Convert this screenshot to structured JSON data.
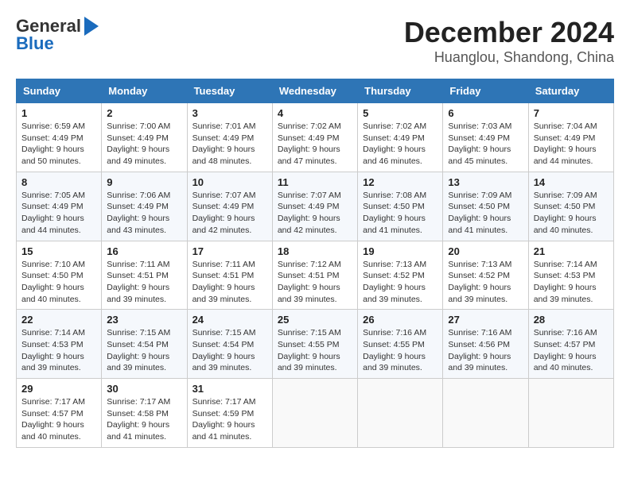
{
  "header": {
    "logo_line1": "General",
    "logo_line2": "Blue",
    "title": "December 2024",
    "subtitle": "Huanglou, Shandong, China"
  },
  "weekdays": [
    "Sunday",
    "Monday",
    "Tuesday",
    "Wednesday",
    "Thursday",
    "Friday",
    "Saturday"
  ],
  "weeks": [
    [
      {
        "day": "1",
        "sunrise": "Sunrise: 6:59 AM",
        "sunset": "Sunset: 4:49 PM",
        "daylight": "Daylight: 9 hours and 50 minutes."
      },
      {
        "day": "2",
        "sunrise": "Sunrise: 7:00 AM",
        "sunset": "Sunset: 4:49 PM",
        "daylight": "Daylight: 9 hours and 49 minutes."
      },
      {
        "day": "3",
        "sunrise": "Sunrise: 7:01 AM",
        "sunset": "Sunset: 4:49 PM",
        "daylight": "Daylight: 9 hours and 48 minutes."
      },
      {
        "day": "4",
        "sunrise": "Sunrise: 7:02 AM",
        "sunset": "Sunset: 4:49 PM",
        "daylight": "Daylight: 9 hours and 47 minutes."
      },
      {
        "day": "5",
        "sunrise": "Sunrise: 7:02 AM",
        "sunset": "Sunset: 4:49 PM",
        "daylight": "Daylight: 9 hours and 46 minutes."
      },
      {
        "day": "6",
        "sunrise": "Sunrise: 7:03 AM",
        "sunset": "Sunset: 4:49 PM",
        "daylight": "Daylight: 9 hours and 45 minutes."
      },
      {
        "day": "7",
        "sunrise": "Sunrise: 7:04 AM",
        "sunset": "Sunset: 4:49 PM",
        "daylight": "Daylight: 9 hours and 44 minutes."
      }
    ],
    [
      {
        "day": "8",
        "sunrise": "Sunrise: 7:05 AM",
        "sunset": "Sunset: 4:49 PM",
        "daylight": "Daylight: 9 hours and 44 minutes."
      },
      {
        "day": "9",
        "sunrise": "Sunrise: 7:06 AM",
        "sunset": "Sunset: 4:49 PM",
        "daylight": "Daylight: 9 hours and 43 minutes."
      },
      {
        "day": "10",
        "sunrise": "Sunrise: 7:07 AM",
        "sunset": "Sunset: 4:49 PM",
        "daylight": "Daylight: 9 hours and 42 minutes."
      },
      {
        "day": "11",
        "sunrise": "Sunrise: 7:07 AM",
        "sunset": "Sunset: 4:49 PM",
        "daylight": "Daylight: 9 hours and 42 minutes."
      },
      {
        "day": "12",
        "sunrise": "Sunrise: 7:08 AM",
        "sunset": "Sunset: 4:50 PM",
        "daylight": "Daylight: 9 hours and 41 minutes."
      },
      {
        "day": "13",
        "sunrise": "Sunrise: 7:09 AM",
        "sunset": "Sunset: 4:50 PM",
        "daylight": "Daylight: 9 hours and 41 minutes."
      },
      {
        "day": "14",
        "sunrise": "Sunrise: 7:09 AM",
        "sunset": "Sunset: 4:50 PM",
        "daylight": "Daylight: 9 hours and 40 minutes."
      }
    ],
    [
      {
        "day": "15",
        "sunrise": "Sunrise: 7:10 AM",
        "sunset": "Sunset: 4:50 PM",
        "daylight": "Daylight: 9 hours and 40 minutes."
      },
      {
        "day": "16",
        "sunrise": "Sunrise: 7:11 AM",
        "sunset": "Sunset: 4:51 PM",
        "daylight": "Daylight: 9 hours and 39 minutes."
      },
      {
        "day": "17",
        "sunrise": "Sunrise: 7:11 AM",
        "sunset": "Sunset: 4:51 PM",
        "daylight": "Daylight: 9 hours and 39 minutes."
      },
      {
        "day": "18",
        "sunrise": "Sunrise: 7:12 AM",
        "sunset": "Sunset: 4:51 PM",
        "daylight": "Daylight: 9 hours and 39 minutes."
      },
      {
        "day": "19",
        "sunrise": "Sunrise: 7:13 AM",
        "sunset": "Sunset: 4:52 PM",
        "daylight": "Daylight: 9 hours and 39 minutes."
      },
      {
        "day": "20",
        "sunrise": "Sunrise: 7:13 AM",
        "sunset": "Sunset: 4:52 PM",
        "daylight": "Daylight: 9 hours and 39 minutes."
      },
      {
        "day": "21",
        "sunrise": "Sunrise: 7:14 AM",
        "sunset": "Sunset: 4:53 PM",
        "daylight": "Daylight: 9 hours and 39 minutes."
      }
    ],
    [
      {
        "day": "22",
        "sunrise": "Sunrise: 7:14 AM",
        "sunset": "Sunset: 4:53 PM",
        "daylight": "Daylight: 9 hours and 39 minutes."
      },
      {
        "day": "23",
        "sunrise": "Sunrise: 7:15 AM",
        "sunset": "Sunset: 4:54 PM",
        "daylight": "Daylight: 9 hours and 39 minutes."
      },
      {
        "day": "24",
        "sunrise": "Sunrise: 7:15 AM",
        "sunset": "Sunset: 4:54 PM",
        "daylight": "Daylight: 9 hours and 39 minutes."
      },
      {
        "day": "25",
        "sunrise": "Sunrise: 7:15 AM",
        "sunset": "Sunset: 4:55 PM",
        "daylight": "Daylight: 9 hours and 39 minutes."
      },
      {
        "day": "26",
        "sunrise": "Sunrise: 7:16 AM",
        "sunset": "Sunset: 4:55 PM",
        "daylight": "Daylight: 9 hours and 39 minutes."
      },
      {
        "day": "27",
        "sunrise": "Sunrise: 7:16 AM",
        "sunset": "Sunset: 4:56 PM",
        "daylight": "Daylight: 9 hours and 39 minutes."
      },
      {
        "day": "28",
        "sunrise": "Sunrise: 7:16 AM",
        "sunset": "Sunset: 4:57 PM",
        "daylight": "Daylight: 9 hours and 40 minutes."
      }
    ],
    [
      {
        "day": "29",
        "sunrise": "Sunrise: 7:17 AM",
        "sunset": "Sunset: 4:57 PM",
        "daylight": "Daylight: 9 hours and 40 minutes."
      },
      {
        "day": "30",
        "sunrise": "Sunrise: 7:17 AM",
        "sunset": "Sunset: 4:58 PM",
        "daylight": "Daylight: 9 hours and 41 minutes."
      },
      {
        "day": "31",
        "sunrise": "Sunrise: 7:17 AM",
        "sunset": "Sunset: 4:59 PM",
        "daylight": "Daylight: 9 hours and 41 minutes."
      },
      null,
      null,
      null,
      null
    ]
  ]
}
